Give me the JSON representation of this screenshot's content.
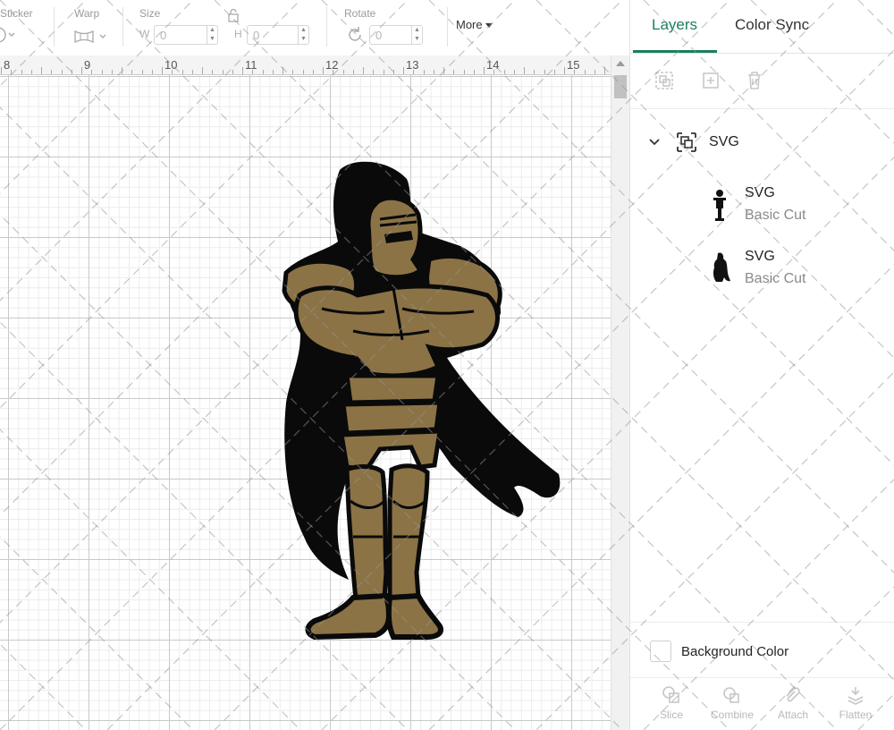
{
  "toolbar": {
    "sticker_label": "Sticker",
    "warp_label": "Warp",
    "size_label": "Size",
    "width_letter": "W",
    "width_value": "0",
    "height_letter": "H",
    "height_value": "0",
    "rotate_label": "Rotate",
    "rotate_value": "0",
    "more_label": "More"
  },
  "ruler": {
    "labels": [
      "8",
      "9",
      "10",
      "11",
      "12",
      "13",
      "14",
      "15"
    ]
  },
  "canvas": {
    "artwork_name": "knight-mascot",
    "colors": {
      "gold": "#8b7346",
      "black": "#0a0a0a"
    }
  },
  "panel": {
    "tabs": {
      "layers": "Layers",
      "color_sync": "Color Sync"
    },
    "action_icons": [
      "group-icon",
      "ungroup-icon",
      "delete-icon"
    ],
    "group": {
      "name": "SVG",
      "items": [
        {
          "name": "SVG",
          "operation": "Basic Cut",
          "thumb": "knight-figure"
        },
        {
          "name": "SVG",
          "operation": "Basic Cut",
          "thumb": "knight-cape"
        }
      ]
    },
    "background_color_label": "Background Color",
    "bottom_tools": [
      "Slice",
      "Combine",
      "Attach",
      "Flatten"
    ],
    "accent_color": "#1a7f5a"
  }
}
